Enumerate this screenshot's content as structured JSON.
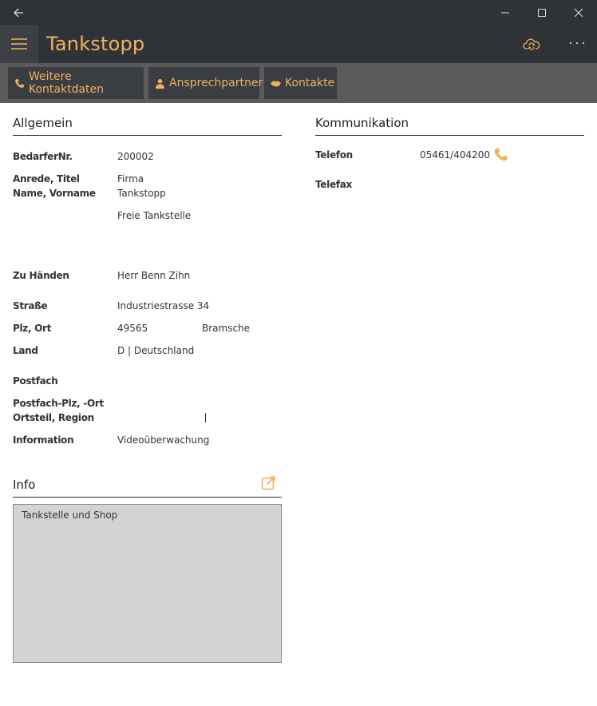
{
  "window": {
    "back_icon": "back-arrow-icon",
    "minimize_icon": "minimize-icon",
    "maximize_icon": "maximize-icon",
    "close_icon": "close-icon"
  },
  "appbar": {
    "title": "Tankstopp",
    "menu_icon": "hamburger-icon",
    "sync_icon": "cloud-sync-icon",
    "more_label": "···",
    "accent": "#f0b25a"
  },
  "toolbar": {
    "buttons": [
      {
        "label": "Weitere Kontaktdaten",
        "icon": "phone-icon"
      },
      {
        "label": "Ansprechpartner",
        "icon": "person-icon"
      },
      {
        "label": "Kontakte",
        "icon": "handshake-icon"
      }
    ]
  },
  "allgemein": {
    "title": "Allgemein",
    "bedarfer_label": "BedarferNr.",
    "bedarfer_value": "200002",
    "anrede_label": "Anrede, Titel",
    "anrede_value": "Firma",
    "name_label": "Name, Vorname",
    "name_value": "Tankstopp",
    "name2_value": "Freie Tankstelle",
    "zuhaenden_label": "Zu Händen",
    "zuhaenden_value": "Herr Benn Zihn",
    "strasse_label": "Straße",
    "strasse_value": "Industriestrasse 34",
    "plzort_label": "Plz, Ort",
    "plz_value": "49565",
    "ort_value": "Bramsche",
    "land_label": "Land",
    "land_value": "D | Deutschland",
    "postfach_label": "Postfach",
    "postfach_plz_label": "Postfach-Plz, -Ort",
    "ortsteil_label": "Ortsteil, Region",
    "information_label": "Information",
    "information_value": "Videoüberwachung"
  },
  "kommunikation": {
    "title": "Kommunikation",
    "telefon_label": "Telefon",
    "telefon_value": "05461/404200",
    "telefax_label": "Telefax"
  },
  "info": {
    "title": "Info",
    "text": "Tankstelle und Shop",
    "edit_icon": "edit-external-icon"
  }
}
